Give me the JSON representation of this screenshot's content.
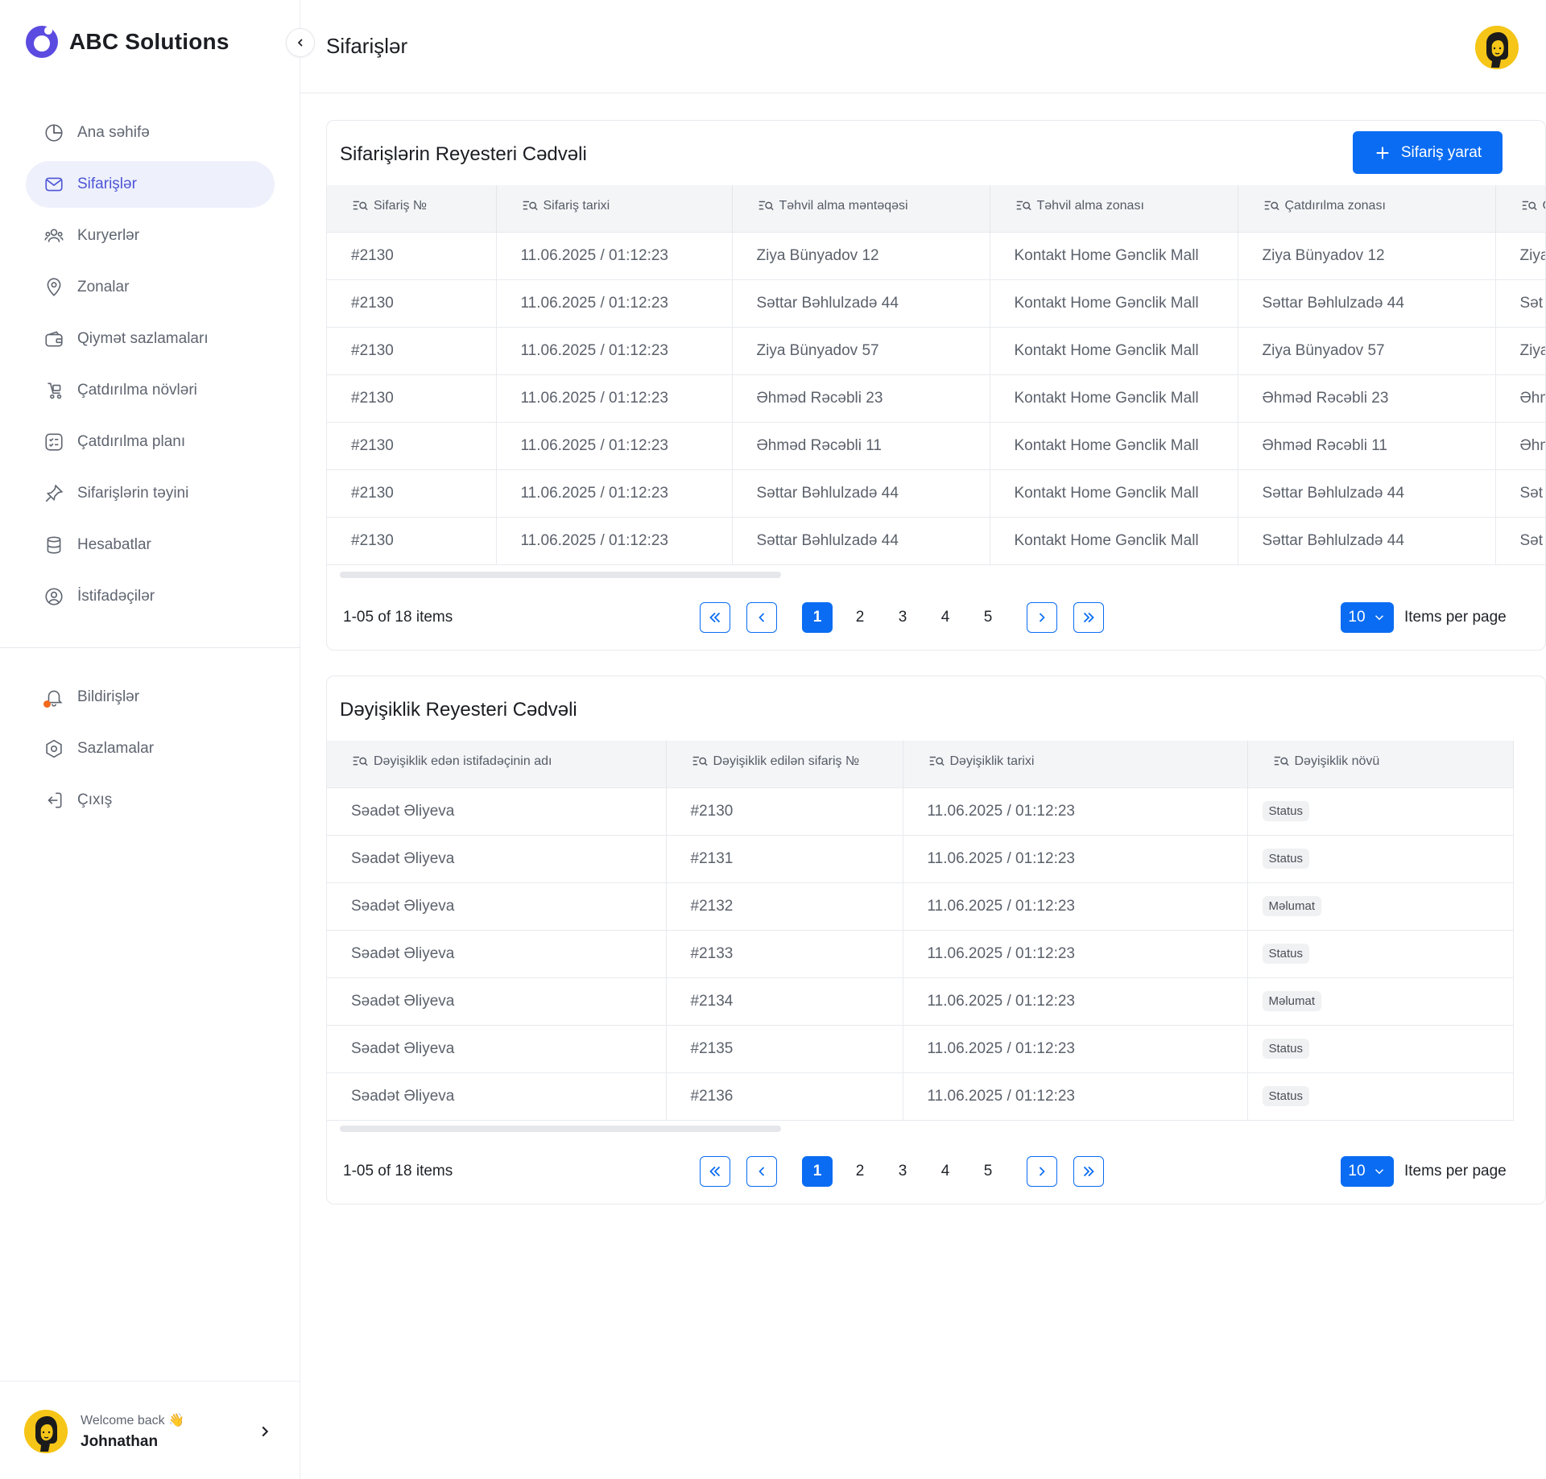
{
  "brand": {
    "name": "ABC Solutions",
    "color": "#5b4be0"
  },
  "page": {
    "title": "Sifarişlər"
  },
  "sidebar": {
    "items": [
      {
        "label": "Ana səhifə",
        "icon": "pie-chart-icon"
      },
      {
        "label": "Sifarişlər",
        "icon": "mail-icon",
        "active": true
      },
      {
        "label": "Kuryerlər",
        "icon": "users-icon"
      },
      {
        "label": "Zonalar",
        "icon": "location-pin-icon"
      },
      {
        "label": "Qiymət sazlamaları",
        "icon": "wallet-icon"
      },
      {
        "label": "Çatdırılma növləri",
        "icon": "delivery-icon"
      },
      {
        "label": "Çatdırılma planı",
        "icon": "checklist-icon"
      },
      {
        "label": "Sifarişlərin təyini",
        "icon": "pin-icon"
      },
      {
        "label": "Hesabatlar",
        "icon": "database-icon"
      },
      {
        "label": "İstifadəçilər",
        "icon": "user-circle-icon"
      }
    ],
    "secondary": [
      {
        "label": "Bildirişlər",
        "icon": "bell-icon"
      },
      {
        "label": "Sazlamalar",
        "icon": "settings-icon"
      },
      {
        "label": "Çıxış",
        "icon": "logout-icon"
      }
    ],
    "welcome": {
      "greeting": "Welcome back 👋",
      "name": "Johnathan"
    }
  },
  "orders_table": {
    "title": "Sifarişlərin Reyesteri Cədvəli",
    "create_label": "Sifariş yarat",
    "columns": [
      "Sifariş №",
      "Sifariş tarixi",
      "Təhvil alma məntəqəsi",
      "Təhvil alma zonası",
      "Çatdırılma  zonası",
      "Ç"
    ],
    "rows": [
      [
        "#2130",
        "11.06.2025 / 01:12:23",
        "Ziya Bünyadov 12",
        "Kontakt Home Gənclik Mall",
        "Ziya Bünyadov 12",
        "Ziya"
      ],
      [
        "#2130",
        "11.06.2025 / 01:12:23",
        "Səttar Bəhlulzadə 44",
        "Kontakt Home Gənclik Mall",
        "Səttar Bəhlulzadə 44",
        "Sət"
      ],
      [
        "#2130",
        "11.06.2025 / 01:12:23",
        "Ziya Bünyadov 57",
        "Kontakt Home Gənclik Mall",
        "Ziya Bünyadov 57",
        "Ziya"
      ],
      [
        "#2130",
        "11.06.2025 / 01:12:23",
        "Əhməd Rəcəbli 23",
        "Kontakt Home Gənclik Mall",
        "Əhməd Rəcəbli 23",
        "Əhm"
      ],
      [
        "#2130",
        "11.06.2025 / 01:12:23",
        "Əhməd Rəcəbli 11",
        "Kontakt Home Gənclik Mall",
        "Əhməd Rəcəbli 11",
        "Əhm"
      ],
      [
        "#2130",
        "11.06.2025 / 01:12:23",
        "Səttar Bəhlulzadə 44",
        "Kontakt Home Gənclik Mall",
        "Səttar Bəhlulzadə 44",
        "Sət"
      ],
      [
        "#2130",
        "11.06.2025 / 01:12:23",
        "Səttar Bəhlulzadə 44",
        "Kontakt Home Gənclik Mall",
        "Səttar Bəhlulzadə 44",
        "Sət"
      ]
    ],
    "pagination": {
      "summary": "1-05 of 18 items",
      "pages": [
        "1",
        "2",
        "3",
        "4",
        "5"
      ],
      "current": "1",
      "per_page": "10",
      "per_page_label": "Items per page"
    }
  },
  "changes_table": {
    "title": "Dəyişiklik Reyesteri Cədvəli",
    "columns": [
      "Dəyişiklik edən istifadəçinin adı",
      "Dəyişiklik edilən sifariş №",
      "Dəyişiklik tarixi",
      "Dəyişiklik növü"
    ],
    "rows": [
      [
        "Səadət Əliyeva",
        "#2130",
        "11.06.2025 / 01:12:23",
        "Status"
      ],
      [
        "Səadət Əliyeva",
        "#2131",
        "11.06.2025 / 01:12:23",
        "Status"
      ],
      [
        "Səadət Əliyeva",
        "#2132",
        "11.06.2025 / 01:12:23",
        "Məlumat"
      ],
      [
        "Səadət Əliyeva",
        "#2133",
        "11.06.2025 / 01:12:23",
        "Status"
      ],
      [
        "Səadət Əliyeva",
        "#2134",
        "11.06.2025 / 01:12:23",
        "Məlumat"
      ],
      [
        "Səadət Əliyeva",
        "#2135",
        "11.06.2025 / 01:12:23",
        "Status"
      ],
      [
        "Səadət Əliyeva",
        "#2136",
        "11.06.2025 / 01:12:23",
        "Status"
      ]
    ],
    "pagination": {
      "summary": "1-05 of 18 items",
      "pages": [
        "1",
        "2",
        "3",
        "4",
        "5"
      ],
      "current": "1",
      "per_page": "10",
      "per_page_label": "Items per page"
    }
  },
  "colors": {
    "primary": "#0a6cf2",
    "nav_active_bg": "#eef0fc",
    "nav_active_text": "#4c55d6",
    "notification_dot": "#f36a1c"
  }
}
